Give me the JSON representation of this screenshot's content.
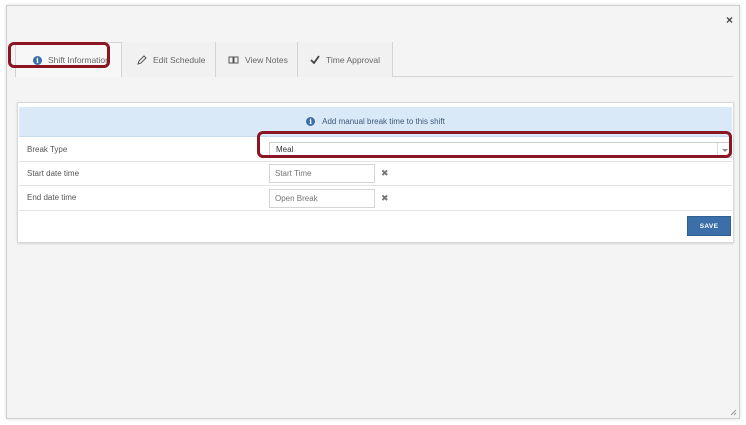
{
  "modal": {
    "close_symbol": "×"
  },
  "tabs": [
    {
      "label": "Shift Information",
      "icon": "info-icon"
    },
    {
      "label": "Edit Schedule",
      "icon": "pencil-icon"
    },
    {
      "label": "View Notes",
      "icon": "book-icon"
    },
    {
      "label": "Time Approval",
      "icon": "checkmark-icon"
    }
  ],
  "banner": {
    "text": "Add manual break time to this shift",
    "icon": "info-icon"
  },
  "form": {
    "break_type": {
      "label": "Break Type",
      "value": "Meal"
    },
    "start": {
      "label": "Start date time",
      "placeholder": "Start Time",
      "clear_symbol": "✖"
    },
    "end": {
      "label": "End date time",
      "placeholder": "Open Break",
      "clear_symbol": "✖"
    },
    "save_label": "SAVE"
  },
  "colors": {
    "accent": "#3a6fa8",
    "highlight": "#8b1520",
    "banner_bg": "#d9e9f7"
  }
}
